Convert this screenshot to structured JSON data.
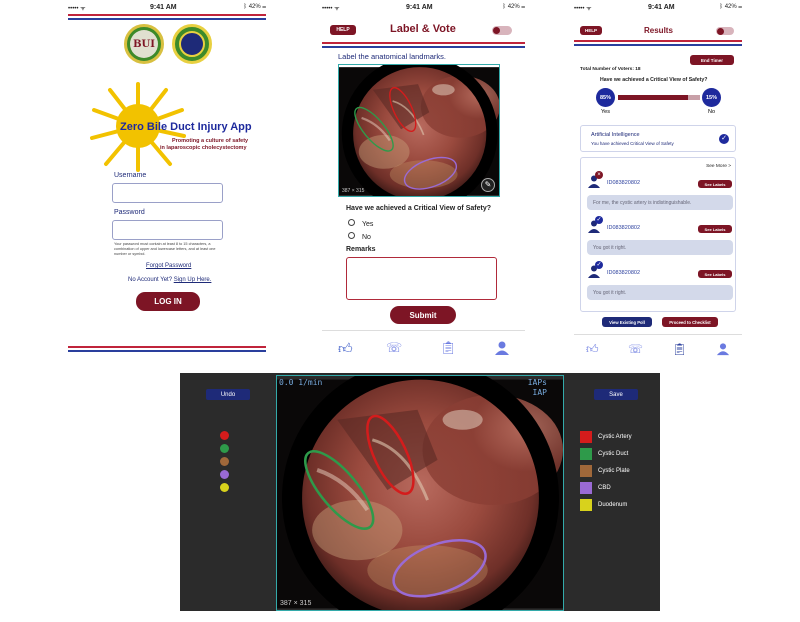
{
  "colors": {
    "maroon": "#7d1525",
    "navy": "#1e2a78",
    "blue": "#2a3f9d",
    "red": "#c0243b"
  },
  "status_bar": {
    "carrier": "•••••  ᯤ",
    "time": "9:41 AM",
    "battery": "42%"
  },
  "login": {
    "logo_left": "BUI",
    "app_title": "Zero Bile Duct Injury App",
    "tagline_1": "Promoting a culture of safety",
    "tagline_2": "in laparoscopic cholecystectomy",
    "username_label": "Username",
    "password_label": "Password",
    "password_hint": "Your password must contain at least 8 to 15 characters, a combination of upper and lowercase letters, and at least one number or symbol.",
    "forgot_password": "Forgot Password",
    "no_account": "No Account Yet?",
    "sign_up": "Sign Up Here.",
    "login_button": "LOG IN"
  },
  "label_vote": {
    "help": "HELP",
    "title": "Label & Vote",
    "instruction": "Label the anatomical landmarks.",
    "image_overlay_tl": "0.0 1/min",
    "image_overlay_tr": "IAPs\nIAP",
    "image_size": "387 × 315",
    "question": "Have we achieved a Critical View of Safety?",
    "options": [
      "Yes",
      "No"
    ],
    "remarks_label": "Remarks",
    "submit": "Submit"
  },
  "results": {
    "help": "HELP",
    "title": "Results",
    "end_timer": "End Timer",
    "total_voters": "Total Number of Voters: 18",
    "question": "Have we achieved a Critical View of Safety?",
    "yes_pct": "85%",
    "no_pct": "15%",
    "yes_label": "Yes",
    "no_label": "No",
    "yes_fraction": 0.85,
    "ai_title": "Artificial Intelligence",
    "ai_text": "You have achieved Critical View of Safety",
    "see_more": "See More >",
    "entries": [
      {
        "id": "ID083820802",
        "button": "See Labels",
        "comment": "For me, the cystic artery is indistinguishable.",
        "verdict": "wrong"
      },
      {
        "id": "ID083820802",
        "button": "See Labels",
        "comment": "You got it right.",
        "verdict": "right"
      },
      {
        "id": "ID083820802",
        "button": "See Labels",
        "comment": "You got it right.",
        "verdict": "right"
      }
    ],
    "view_poll": "View Existing Poll",
    "proceed": "Proceed to Checklist"
  },
  "editor": {
    "undo": "Undo",
    "save": "Save",
    "overlay_tl": "0.0 1/min",
    "overlay_tr_1": "IAPs",
    "overlay_tr_2": "IAP",
    "image_size": "387 × 315",
    "legend": [
      {
        "label": "Cystic Artery",
        "color": "#d41c1c"
      },
      {
        "label": "Cystic Duct",
        "color": "#2e9a4a"
      },
      {
        "label": "Cystic Plate",
        "color": "#a0683a"
      },
      {
        "label": "CBD",
        "color": "#9a6ad4"
      },
      {
        "label": "Duodenum",
        "color": "#d8d21c"
      }
    ]
  },
  "nav_icons": [
    "like-icon",
    "call-icon",
    "clipboard-icon",
    "user-icon"
  ]
}
